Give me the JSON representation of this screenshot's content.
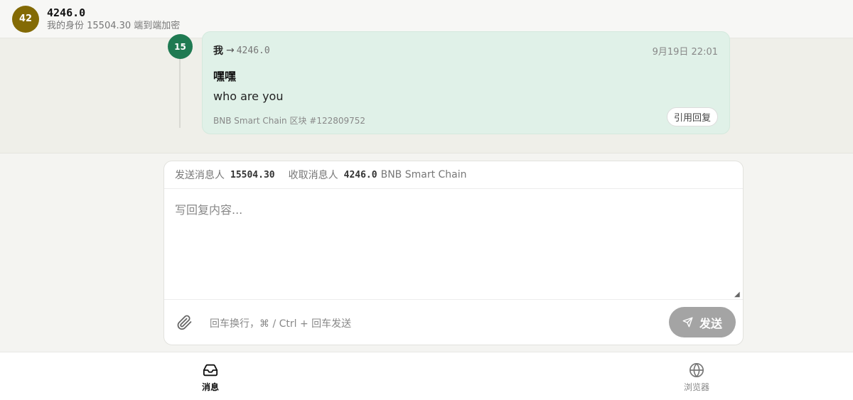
{
  "header": {
    "avatar_text": "42",
    "avatar_color": "#836a04",
    "title": "4246.0",
    "subtitle": "我的身份 15504.30 端到端加密"
  },
  "thread": {
    "seq_badge": "15",
    "seq_color": "#1f7a52",
    "message": {
      "from": "我",
      "arrow": "→",
      "to": "4246.0",
      "time": "9月19日 22:01",
      "subject": "嘿嘿",
      "body": "who are you",
      "chain_info": "BNB Smart Chain 区块 #122809752",
      "quote_button": "引用回复"
    }
  },
  "compose": {
    "sender_label": "发送消息人",
    "sender_value": "15504.30",
    "receiver_label": "收取消息人",
    "receiver_value": "4246.0",
    "chain": "BNB Smart Chain",
    "placeholder": "写回复内容...",
    "hint": "回车换行，⌘ / Ctrl + 回车发送",
    "send_label": "发送",
    "send_color": "#a4a4a4"
  },
  "bottom_nav": {
    "items": [
      {
        "label": "消息",
        "icon": "inbox-icon",
        "active": true
      },
      {
        "label": "浏览器",
        "icon": "globe-icon",
        "active": false
      }
    ]
  }
}
